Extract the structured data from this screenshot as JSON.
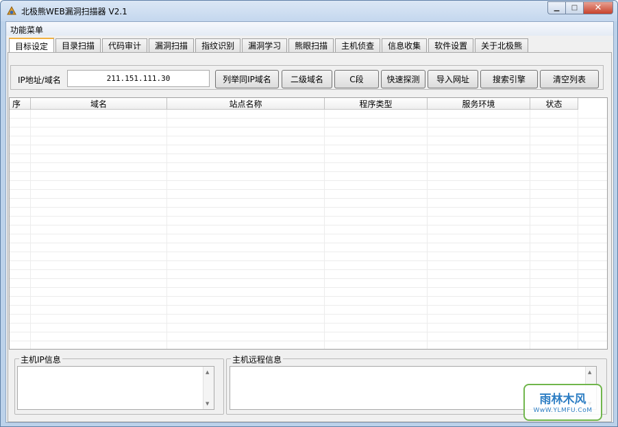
{
  "window": {
    "title": "北极熊WEB漏洞扫描器 V2.1",
    "close_symbol": "✕",
    "max_symbol": "□",
    "min_symbol": "▁"
  },
  "menu": {
    "label": "功能菜单"
  },
  "tabs": [
    {
      "label": "目标设定",
      "active": true
    },
    {
      "label": "目录扫描"
    },
    {
      "label": "代码审计"
    },
    {
      "label": "漏洞扫描"
    },
    {
      "label": "指纹识别"
    },
    {
      "label": "漏洞学习"
    },
    {
      "label": "熊眼扫描"
    },
    {
      "label": "主机侦查"
    },
    {
      "label": "信息收集"
    },
    {
      "label": "软件设置"
    },
    {
      "label": "关于北极熊"
    }
  ],
  "target": {
    "ip_label": "IP地址/域名",
    "ip_value": "211.151.111.30",
    "buttons": [
      "列举同IP域名",
      "二级域名",
      "C段",
      "快速探测",
      "导入网址",
      "搜索引擎",
      "清空列表"
    ]
  },
  "list": {
    "columns": [
      "序",
      "域名",
      "站点名称",
      "程序类型",
      "服务环境",
      "状态"
    ]
  },
  "host_ip_group": {
    "label": "主机IP信息"
  },
  "host_remote_group": {
    "label": "主机远程信息"
  },
  "watermark": {
    "top": "雨林木风",
    "bottom": "WwW.YLMFU.CoM"
  },
  "colors": {
    "active_tab_accent": "#f0b040",
    "title_bar": "#c4d7ee",
    "close_button": "#c7422c"
  }
}
